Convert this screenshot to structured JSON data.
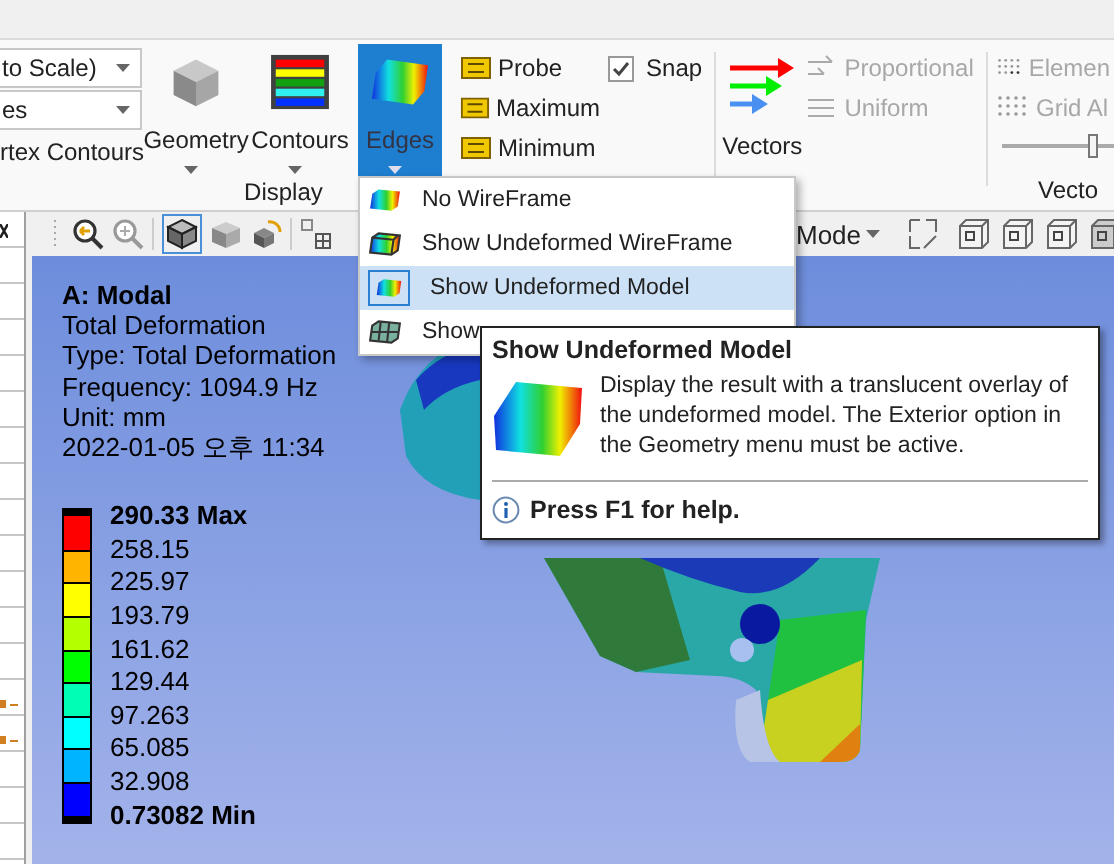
{
  "ribbon": {
    "view_dropdowns": [
      {
        "value": "to Scale)"
      },
      {
        "value": "es"
      }
    ],
    "contour_option_label": "rtex Contours",
    "display_buttons": [
      {
        "label": "Geometry",
        "selected": false,
        "kind": "geometry"
      },
      {
        "label": "Contours",
        "selected": false,
        "kind": "contours"
      },
      {
        "label": "Edges",
        "selected": true,
        "kind": "edges"
      }
    ],
    "display_group_label": "Display",
    "probe_tools": [
      {
        "label": "Probe"
      },
      {
        "label": "Maximum"
      },
      {
        "label": "Minimum"
      }
    ],
    "snap": {
      "label": "Snap",
      "checked": true
    },
    "vectors_button": {
      "label": "Vectors"
    },
    "vector_modes": [
      {
        "label": "Proportional",
        "disabled": true
      },
      {
        "label": "Uniform",
        "disabled": true
      }
    ],
    "vector_display": [
      {
        "label": "Elemen",
        "disabled": true
      },
      {
        "label": "Grid Al",
        "disabled": true
      }
    ],
    "vector_slider": {
      "level": 0.78
    },
    "vector_group_label": "Vecto"
  },
  "toolbar": {
    "mode_label": "Mode"
  },
  "result": {
    "title": "A: Modal",
    "lines": [
      "Total Deformation",
      "Type: Total Deformation",
      "Frequency: 1094.9 Hz",
      "Unit: mm",
      "2022-01-05 오후 11:34"
    ]
  },
  "legend": {
    "labels": [
      "290.33 Max",
      "258.15",
      "225.97",
      "193.79",
      "161.62",
      "129.44",
      "97.263",
      "65.085",
      "32.908",
      "0.73082 Min"
    ],
    "bands": [
      {
        "color": "#ff0000"
      },
      {
        "color": "#ffb400"
      },
      {
        "color": "#ffff00"
      },
      {
        "color": "#b4ff00"
      },
      {
        "color": "#00ff00"
      },
      {
        "color": "#00ffb4"
      },
      {
        "color": "#00ffff"
      },
      {
        "color": "#00b4ff"
      },
      {
        "color": "#0000ff"
      }
    ]
  },
  "edges_menu": [
    {
      "label": "No WireFrame",
      "selected": false,
      "kind": "none"
    },
    {
      "label": "Show Undeformed WireFrame",
      "selected": false,
      "kind": "wireframe"
    },
    {
      "label": "Show Undeformed Model",
      "selected": true,
      "kind": "model"
    },
    {
      "label": "Show",
      "selected": false,
      "kind": "elements"
    }
  ],
  "tooltip": {
    "title": "Show Undeformed Model",
    "description": "Display the result with a translucent overlay of the undeformed model. The Exterior option in the Geometry menu must be active.",
    "help": "Press F1 for help."
  }
}
